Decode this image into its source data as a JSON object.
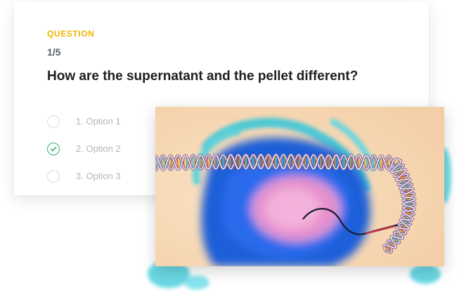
{
  "quiz": {
    "kicker": "QUESTION",
    "counter": "1/5",
    "question": "How are the supernatant and the pellet different?",
    "options": [
      {
        "label": "1. Option 1",
        "checked": false
      },
      {
        "label": "2. Option 2",
        "checked": true
      },
      {
        "label": "3. Option 3",
        "checked": false
      }
    ]
  },
  "colors": {
    "kicker": "#f0b400",
    "check": "#2bb673",
    "option_text": "#b5b5b5"
  },
  "illustration": {
    "subject": "dna-double-helix-over-cell"
  }
}
